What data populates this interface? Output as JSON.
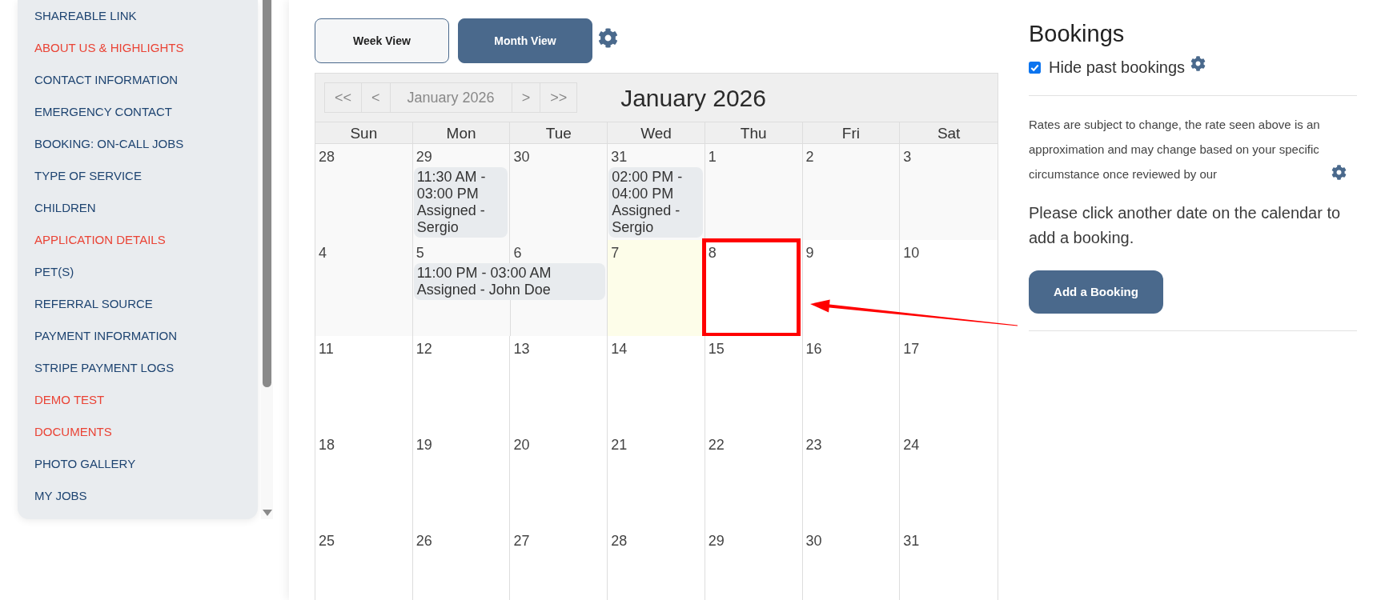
{
  "sidebar": {
    "items": [
      {
        "label": "SHAREABLE LINK",
        "color": "#1e4471"
      },
      {
        "label": "ABOUT US & HIGHLIGHTS",
        "color": "#ea4335"
      },
      {
        "label": "CONTACT INFORMATION",
        "color": "#1e4471"
      },
      {
        "label": "EMERGENCY CONTACT",
        "color": "#1e4471"
      },
      {
        "label": "BOOKING: ON-CALL JOBS",
        "color": "#1e4471"
      },
      {
        "label": "TYPE OF SERVICE",
        "color": "#1e4471"
      },
      {
        "label": "CHILDREN",
        "color": "#1e4471"
      },
      {
        "label": "APPLICATION DETAILS",
        "color": "#ea4335"
      },
      {
        "label": "PET(S)",
        "color": "#1e4471"
      },
      {
        "label": "REFERRAL SOURCE",
        "color": "#1e4471"
      },
      {
        "label": "PAYMENT INFORMATION",
        "color": "#1e4471"
      },
      {
        "label": "STRIPE PAYMENT LOGS",
        "color": "#1e4471"
      },
      {
        "label": "DEMO TEST",
        "color": "#ea4335"
      },
      {
        "label": "DOCUMENTS",
        "color": "#ea4335"
      },
      {
        "label": "PHOTO GALLERY",
        "color": "#1e4471"
      },
      {
        "label": "MY JOBS",
        "color": "#1e4471"
      }
    ]
  },
  "view_toggle": [
    {
      "label": "Week View",
      "selected": false
    },
    {
      "label": "Month View",
      "selected": true
    }
  ],
  "calendar": {
    "nav": [
      "<<",
      "<",
      "January 2026",
      ">",
      ">>"
    ],
    "title": "January 2026",
    "weekdays": [
      "Sun",
      "Mon",
      "Tue",
      "Wed",
      "Thu",
      "Fri",
      "Sat"
    ],
    "weeks": [
      [
        {
          "day": "28",
          "kind": "past",
          "highlighted": false
        },
        {
          "day": "29",
          "kind": "past",
          "highlighted": false,
          "events": [
            {
              "time": "11:30 AM - 03:00 PM",
              "label": "Assigned - Sergio",
              "multi_day": false
            }
          ]
        },
        {
          "day": "30",
          "kind": "past",
          "highlighted": false
        },
        {
          "day": "31",
          "kind": "past",
          "highlighted": false,
          "events": [
            {
              "time": "02:00 PM - 04:00 PM",
              "label": "Assigned - Sergio",
              "multi_day": false
            }
          ]
        },
        {
          "day": "1",
          "kind": "past",
          "highlighted": false
        },
        {
          "day": "2",
          "kind": "past",
          "highlighted": false
        },
        {
          "day": "3",
          "kind": "past",
          "highlighted": false
        }
      ],
      [
        {
          "day": "4",
          "kind": "past",
          "highlighted": false
        },
        {
          "day": "5",
          "kind": "past",
          "highlighted": false,
          "events": [
            {
              "time": "11:00 PM - 03:00 AM",
              "label": "Assigned - John Doe",
              "multi_day": true
            }
          ]
        },
        {
          "day": "6",
          "kind": "past",
          "highlighted": false
        },
        {
          "day": "7",
          "kind": "today",
          "highlighted": false
        },
        {
          "day": "8",
          "kind": "future",
          "highlighted": true
        },
        {
          "day": "9",
          "kind": "future",
          "highlighted": false
        },
        {
          "day": "10",
          "kind": "future",
          "highlighted": false
        }
      ],
      [
        {
          "day": "11",
          "kind": "future",
          "highlighted": false
        },
        {
          "day": "12",
          "kind": "future",
          "highlighted": false
        },
        {
          "day": "13",
          "kind": "future",
          "highlighted": false
        },
        {
          "day": "14",
          "kind": "future",
          "highlighted": false
        },
        {
          "day": "15",
          "kind": "future",
          "highlighted": false
        },
        {
          "day": "16",
          "kind": "future",
          "highlighted": false
        },
        {
          "day": "17",
          "kind": "future",
          "highlighted": false
        }
      ],
      [
        {
          "day": "18",
          "kind": "future",
          "highlighted": false
        },
        {
          "day": "19",
          "kind": "future",
          "highlighted": false
        },
        {
          "day": "20",
          "kind": "future",
          "highlighted": false
        },
        {
          "day": "21",
          "kind": "future",
          "highlighted": false
        },
        {
          "day": "22",
          "kind": "future",
          "highlighted": false
        },
        {
          "day": "23",
          "kind": "future",
          "highlighted": false
        },
        {
          "day": "24",
          "kind": "future",
          "highlighted": false
        }
      ],
      [
        {
          "day": "25",
          "kind": "future",
          "highlighted": false
        },
        {
          "day": "26",
          "kind": "future",
          "highlighted": false
        },
        {
          "day": "27",
          "kind": "future",
          "highlighted": false
        },
        {
          "day": "28",
          "kind": "future",
          "highlighted": false
        },
        {
          "day": "29",
          "kind": "future",
          "highlighted": false
        },
        {
          "day": "30",
          "kind": "future",
          "highlighted": false
        },
        {
          "day": "31",
          "kind": "future",
          "highlighted": false
        }
      ]
    ]
  },
  "bookings_panel": {
    "title": "Bookings",
    "hide_past": {
      "label": "Hide past bookings",
      "checked": true
    },
    "notice": "Rates are subject to change, the rate seen above is an approximation and may change based on your specific circumstance once reviewed by our",
    "prompt": "Please click another date on the calendar to add a booking.",
    "add_button": "Add a Booking"
  }
}
